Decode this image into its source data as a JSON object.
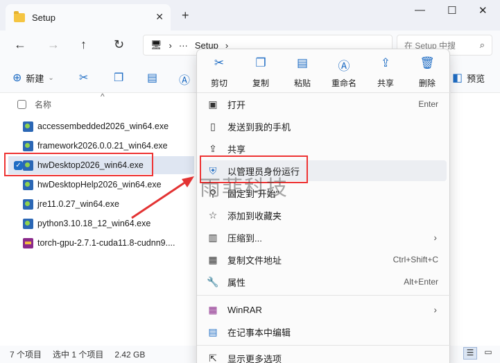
{
  "window": {
    "tab_title": "Setup",
    "close_tab": "✕",
    "new_tab": "+",
    "minimize": "—",
    "maximize": "☐",
    "close": "✕"
  },
  "nav": {
    "back": "←",
    "forward": "→",
    "up": "↑",
    "refresh": "↻",
    "computer_icon": "🖥",
    "sep1": "›",
    "ellipsis": "···",
    "path_current": "Setup",
    "sep2": "›",
    "search_placeholder": "在 Setup 中搜",
    "search_icon": "⌕"
  },
  "toolbar": {
    "new_label": "新建",
    "preview_label": "预览"
  },
  "list": {
    "name_header": "名称",
    "files": [
      {
        "name": "accessembedded2026_win64.exe",
        "type": "exe"
      },
      {
        "name": "framework2026.0.0.21_win64.exe",
        "type": "exe"
      },
      {
        "name": "hwDesktop2026_win64.exe",
        "type": "exe",
        "selected": true
      },
      {
        "name": "hwDesktopHelp2026_win64.exe",
        "type": "exe"
      },
      {
        "name": "jre11.0.27_win64.exe",
        "type": "exe"
      },
      {
        "name": "python3.10.18_12_win64.exe",
        "type": "exe"
      },
      {
        "name": "torch-gpu-2.7.1-cuda11.8-cudnn9....",
        "type": "rar"
      }
    ]
  },
  "status": {
    "count": "7 个项目",
    "selected": "选中 1 个项目",
    "size": "2.42 GB"
  },
  "context_menu": {
    "quick_actions": [
      {
        "label": "剪切",
        "icon": "scissors-icon"
      },
      {
        "label": "复制",
        "icon": "copy-icon"
      },
      {
        "label": "粘贴",
        "icon": "paste-icon"
      },
      {
        "label": "重命名",
        "icon": "rename-icon"
      },
      {
        "label": "共享",
        "icon": "share-icon"
      },
      {
        "label": "删除",
        "icon": "trash-icon"
      }
    ],
    "items": [
      {
        "label": "打开",
        "shortcut": "Enter",
        "icon": "open-icon"
      },
      {
        "label": "发送到我的手机",
        "shortcut": "",
        "icon": "phone-icon"
      },
      {
        "label": "共享",
        "shortcut": "",
        "icon": "share-icon"
      },
      {
        "label": "以管理员身份运行",
        "shortcut": "",
        "icon": "shield-icon"
      },
      {
        "label": "固定到\"开始\"",
        "shortcut": "",
        "icon": "pin-icon"
      },
      {
        "label": "添加到收藏夹",
        "shortcut": "",
        "icon": "star-icon"
      },
      {
        "label": "压缩到...",
        "shortcut": "",
        "icon": "archive-icon",
        "submenu": true
      },
      {
        "label": "复制文件地址",
        "shortcut": "Ctrl+Shift+C",
        "icon": "path-icon"
      },
      {
        "label": "属性",
        "shortcut": "Alt+Enter",
        "icon": "wrench-icon"
      },
      {
        "label": "WinRAR",
        "shortcut": "",
        "icon": "winrar-icon",
        "submenu": true
      },
      {
        "label": "在记事本中编辑",
        "shortcut": "",
        "icon": "notepad-icon"
      },
      {
        "label": "显示更多选项",
        "shortcut": "",
        "icon": "more-options-icon"
      }
    ]
  },
  "watermark": "雨菲科技",
  "colors": {
    "accent": "#1f6dc4",
    "highlight": "#e33333"
  }
}
